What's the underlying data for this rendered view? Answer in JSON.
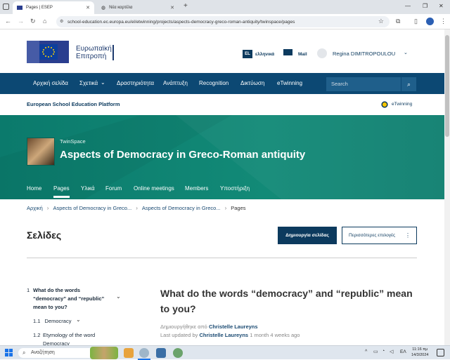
{
  "browser": {
    "tabs": [
      {
        "title": "Pages | ESEP",
        "active": true
      },
      {
        "title": "Νέα καρτέλα",
        "active": false
      }
    ],
    "new_tab": "+",
    "url": "school-education.ec.europa.eu/el/etwinning/projects/aspects-democracy-greco-roman-antiquity/twinspace/pages"
  },
  "header": {
    "logo_line1": "Ευρωπαϊκή",
    "logo_line2": "Επιτροπή",
    "lang_code": "EL",
    "lang_label": "ελληνικά",
    "mail_label": "Mail",
    "user_name": "Regina DIMITROPOULOU"
  },
  "mainnav": {
    "items": [
      "Αρχική σελίδα",
      "Σχετικά",
      "Δραστηριότητα",
      "Ανάπτυξη",
      "Recognition",
      "Δικτύωση",
      "eTwinning"
    ],
    "search_placeholder": "Search"
  },
  "platform": {
    "title": "European School Education Platform",
    "etwinning_logo": "eTwinning"
  },
  "banner": {
    "kicker": "TwinSpace",
    "title": "Aspects of Democracy in Greco-Roman antiquity",
    "tabs": [
      "Home",
      "Pages",
      "Υλικά",
      "Forum",
      "Online meetings",
      "Members",
      "Υποστήριξη"
    ],
    "active_tab": "Pages"
  },
  "breadcrumb": [
    "Αρχική",
    "Aspects of Democracy in Greco...",
    "Aspects of Democracy in Greco...",
    "Pages"
  ],
  "page": {
    "title": "Σελίδες",
    "create_button": "Δημιουργία σελίδας",
    "more_button": "Περισσότερες επιλογές"
  },
  "toc": [
    {
      "num": "1",
      "line1": "What do the words",
      "line2": "“democracy” and “republic”",
      "line3": "mean to you?"
    },
    {
      "num": "1.1",
      "label": "Democracy"
    },
    {
      "num": "1.2",
      "line1": "Etymology of the word",
      "line2": "Democracy"
    }
  ],
  "article": {
    "title": "What do the words “democracy” and “republic” mean to you?",
    "created_prefix": "Δημιουργήθηκε από",
    "created_by": "Christelle Laureyns",
    "updated_prefix": "Last updated by",
    "updated_by": "Christelle Laureyns",
    "updated_when": "1 month 4 weeks ago"
  },
  "taskbar": {
    "search_placeholder": "Αναζήτηση",
    "lang": "ΕΛ",
    "time": "11:16 πμ",
    "date": "14/3/2024"
  }
}
